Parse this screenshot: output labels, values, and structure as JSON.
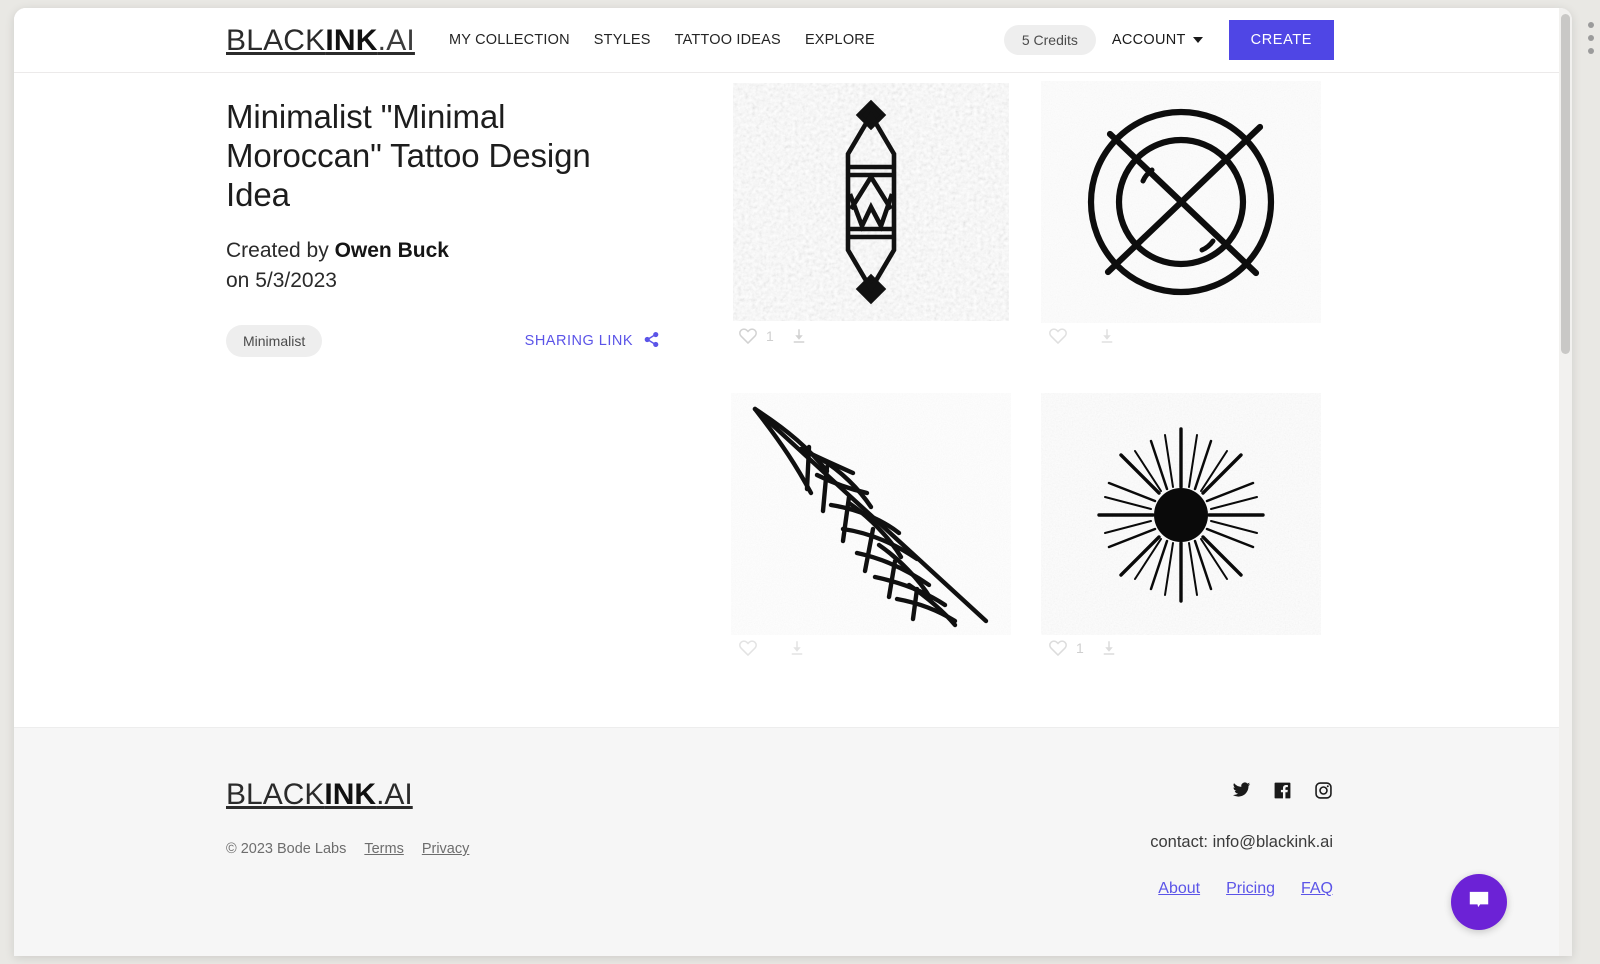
{
  "header": {
    "brand_black": "BLACK",
    "brand_ink": "INK",
    "brand_dot_ai": ".AI",
    "nav": [
      {
        "label": "MY COLLECTION"
      },
      {
        "label": "STYLES"
      },
      {
        "label": "TATTOO IDEAS"
      },
      {
        "label": "EXPLORE"
      }
    ],
    "credits": "5 Credits",
    "account": "ACCOUNT",
    "create": "CREATE"
  },
  "detail": {
    "title": "Minimalist \"Minimal Moroccan\" Tattoo Design Idea",
    "created_prefix": "Created by ",
    "author": "Owen Buck",
    "created_on": "on 5/3/2023",
    "tag": "Minimalist",
    "share_label": "SHARING LINK",
    "share_icon": "share-icon"
  },
  "gallery": {
    "tiles": [
      {
        "alt": "minimal-moroccan-crystal-motif",
        "like_count": "1",
        "liked": false,
        "like_icon": "heart-outline-icon",
        "download_icon": "download-icon"
      },
      {
        "alt": "crossed-circle-geometric-motif",
        "like_count": "",
        "liked": false,
        "like_icon": "heart-outline-icon",
        "download_icon": "download-icon"
      },
      {
        "alt": "linework-feather-motif",
        "like_count": "",
        "liked": false,
        "like_icon": "heart-outline-icon",
        "download_icon": "download-icon"
      },
      {
        "alt": "sunburst-rays-motif",
        "like_count": "1",
        "liked": false,
        "like_icon": "heart-outline-icon",
        "download_icon": "download-icon"
      }
    ]
  },
  "footer": {
    "brand_black": "BLACK",
    "brand_ink": "INK",
    "brand_dot_ai": ".AI",
    "copyright": "© 2023 Bode Labs",
    "terms": "Terms",
    "privacy": "Privacy",
    "social": [
      {
        "name": "twitter-icon"
      },
      {
        "name": "facebook-icon"
      },
      {
        "name": "instagram-icon"
      }
    ],
    "contact": "contact: info@blackink.ai",
    "links": [
      {
        "label": "About"
      },
      {
        "label": "Pricing"
      },
      {
        "label": "FAQ"
      }
    ]
  },
  "widgets": {
    "chat_icon": "chat-bubble-icon"
  },
  "colors": {
    "accent": "#4f46e5",
    "link": "#5b54e8",
    "chat": "#6c22d6",
    "pill_bg": "#eeeeee",
    "footer_bg": "#f6f6f6"
  }
}
